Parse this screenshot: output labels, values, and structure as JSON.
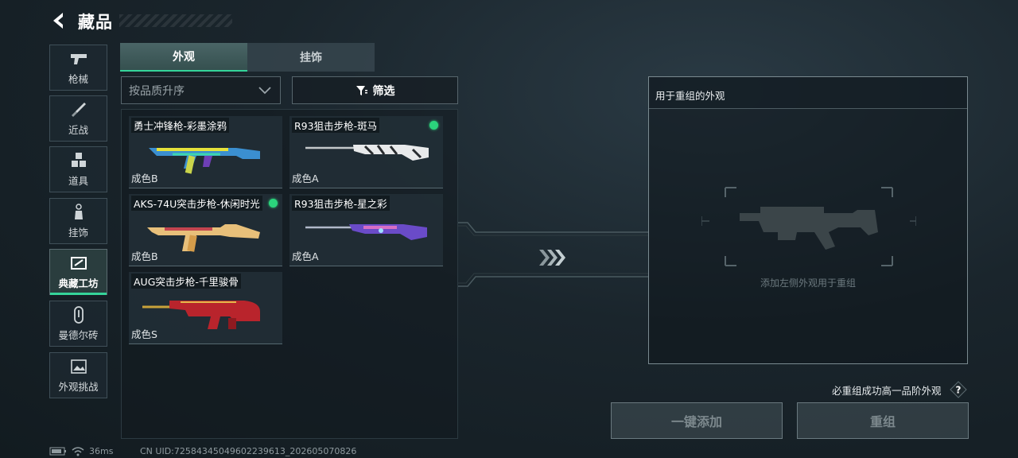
{
  "header": {
    "title": "藏品"
  },
  "sidebar": {
    "items": [
      {
        "label": "枪械",
        "icon": "pistol-icon"
      },
      {
        "label": "近战",
        "icon": "knife-icon"
      },
      {
        "label": "道具",
        "icon": "cubes-icon"
      },
      {
        "label": "挂饰",
        "icon": "charm-icon"
      },
      {
        "label": "典藏工坊",
        "icon": "workshop-icon",
        "active": true
      },
      {
        "label": "曼德尔砖",
        "icon": "brick-icon"
      },
      {
        "label": "外观挑战",
        "icon": "picture-icon"
      }
    ]
  },
  "tabs": [
    {
      "label": "外观",
      "active": true
    },
    {
      "label": "挂饰",
      "active": false
    }
  ],
  "sort": {
    "value": "按品质升序"
  },
  "filter": {
    "label": "筛选"
  },
  "cards": [
    {
      "name": "勇士冲锋枪-彩墨涂鸦",
      "grade": "成色B",
      "new": false
    },
    {
      "name": "R93狙击步枪-斑马",
      "grade": "成色A",
      "new": true
    },
    {
      "name": "AKS-74U突击步枪-休闲时光",
      "grade": "成色B",
      "new": true
    },
    {
      "name": "R93狙击步枪-星之彩",
      "grade": "成色A",
      "new": false
    },
    {
      "name": "AUG突击步枪-千里骏骨",
      "grade": "成色S",
      "new": false
    }
  ],
  "recombine": {
    "panel_title": "用于重组的外观",
    "hint": "添加左侧外观用于重组",
    "success_note": "必重组成功高一品阶外观",
    "quick_add_label": "一键添加",
    "recombine_label": "重组"
  },
  "status": {
    "ping": "36ms",
    "uid": "CN UID:72584345049602239613_202605070826"
  },
  "colors": {
    "accent": "#35d59a",
    "new_dot": "#2bd47c"
  }
}
